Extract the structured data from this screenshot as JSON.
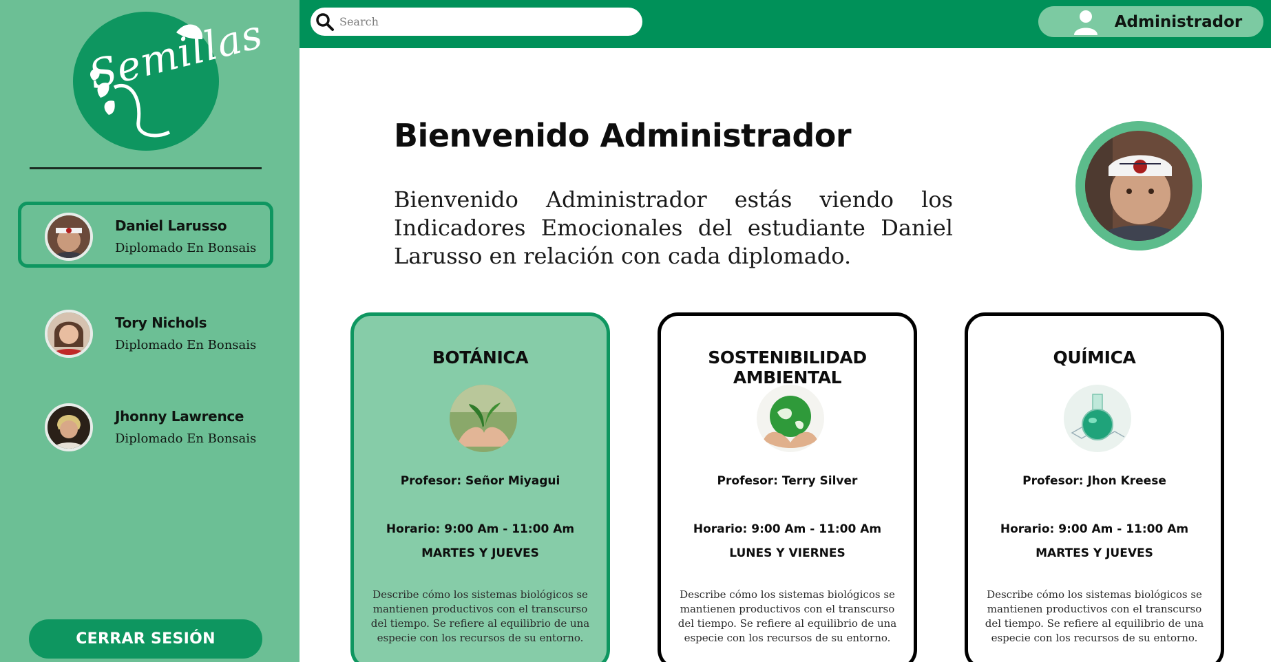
{
  "sidebar": {
    "logo_text": "Semillas",
    "students": [
      {
        "name": "Daniel Larusso",
        "course": "Diplomado En Bonsais",
        "active": true
      },
      {
        "name": "Tory Nichols",
        "course": "Diplomado En Bonsais",
        "active": false
      },
      {
        "name": "Jhonny Lawrence",
        "course": "Diplomado En Bonsais",
        "active": false
      }
    ],
    "logout_label": "CERRAR SESIÓN"
  },
  "topbar": {
    "search_placeholder": "Search",
    "user_name": "Administrador"
  },
  "main": {
    "title": "Bienvenido Administrador",
    "intro": "Bienvenido Administrador estás viendo los Indicadores Emocionales del estudiante Daniel Larusso en relación con cada diplomado.",
    "cards": [
      {
        "title": "BOTÁNICA",
        "professor": "Profesor: Señor Miyagui",
        "schedule": "Horario: 9:00 Am - 11:00 Am",
        "days": "MARTES Y JUEVES",
        "description": "Describe cómo los sistemas biológicos se mantienen productivos con el transcurso del tiempo. Se refiere al equilibrio de una especie con los recursos de su entorno.",
        "active": true
      },
      {
        "title": "SOSTENIBILIDAD AMBIENTAL",
        "professor": "Profesor: Terry Silver",
        "schedule": "Horario: 9:00 Am - 11:00 Am",
        "days": "LUNES Y VIERNES",
        "description": "Describe cómo los sistemas biológicos se mantienen productivos con el transcurso del tiempo. Se refiere al equilibrio de una especie con los recursos de su entorno.",
        "active": false
      },
      {
        "title": "QUÍMICA",
        "professor": "Profesor: Jhon Kreese",
        "schedule": "Horario: 9:00 Am - 11:00 Am",
        "days": "MARTES Y JUEVES",
        "description": "Describe cómo los sistemas biológicos se mantienen productivos con el transcurso del tiempo. Se refiere al equilibrio de una especie con los recursos de su entorno.",
        "active": false
      }
    ]
  },
  "colors": {
    "sidebar_bg": "#6cbf95",
    "brand_green": "#009159",
    "active_card_bg": "#86cca8",
    "user_pill_bg": "#7ccaa2"
  }
}
